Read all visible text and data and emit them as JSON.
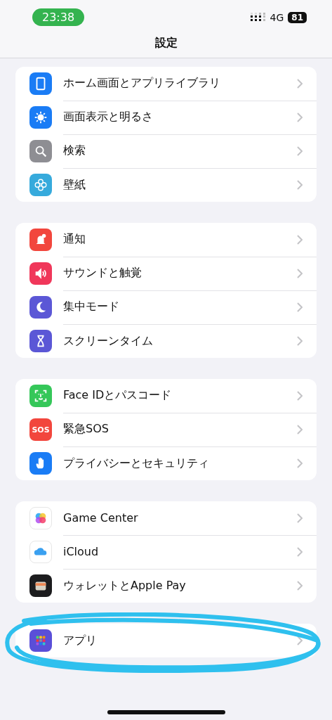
{
  "status_bar": {
    "time": "23:38",
    "network": "4G",
    "battery": "81"
  },
  "nav": {
    "title": "設定"
  },
  "groups": [
    {
      "rows": [
        {
          "label": "ホーム画面とアプリライブラリ"
        },
        {
          "label": "画面表示と明るさ"
        },
        {
          "label": "検索"
        },
        {
          "label": "壁紙"
        }
      ]
    },
    {
      "rows": [
        {
          "label": "通知"
        },
        {
          "label": "サウンドと触覚"
        },
        {
          "label": "集中モード"
        },
        {
          "label": "スクリーンタイム"
        }
      ]
    },
    {
      "rows": [
        {
          "label": "Face IDとパスコード"
        },
        {
          "label": "緊急SOS",
          "badge": "SOS"
        },
        {
          "label": "プライバシーとセキュリティ"
        }
      ]
    },
    {
      "rows": [
        {
          "label": "Game Center"
        },
        {
          "label": "iCloud"
        },
        {
          "label": "ウォレットとApple Pay"
        }
      ]
    },
    {
      "rows": [
        {
          "label": "アプリ"
        }
      ],
      "circled": true
    }
  ]
}
